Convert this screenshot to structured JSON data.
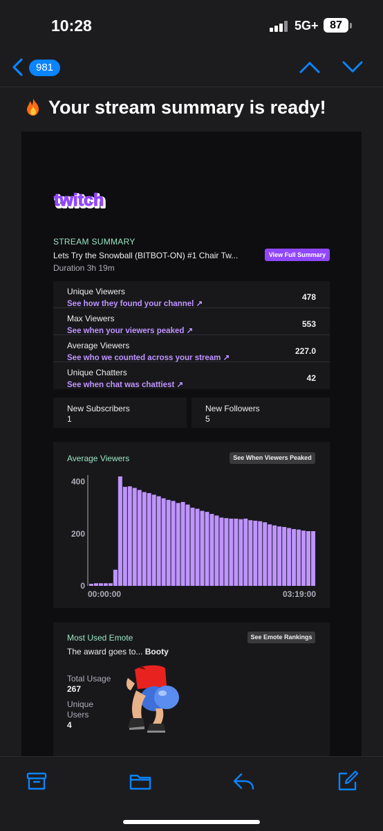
{
  "status": {
    "time": "10:28",
    "network": "5G+",
    "battery": "87"
  },
  "nav": {
    "unread_count": "981"
  },
  "email": {
    "subject": "Your stream summary is ready!",
    "logo_text": "twitch",
    "summary_label": "STREAM SUMMARY",
    "stream_title": "Lets Try the Snowball (BITBOT-ON) #1 Chair Tw...",
    "duration": "Duration 3h 19m",
    "full_summary_button": "View Full Summary",
    "metrics": [
      {
        "label": "Unique Viewers",
        "link": "See how they found your channel",
        "value": "478"
      },
      {
        "label": "Max Viewers",
        "link": "See when your viewers peaked",
        "value": "553"
      },
      {
        "label": "Average Viewers",
        "link": "See who we counted across your stream",
        "value": "227.0"
      },
      {
        "label": "Unique Chatters",
        "link": "See when chat was chattiest",
        "value": "42"
      }
    ],
    "tiles": [
      {
        "label": "New Subscribers",
        "value": "1"
      },
      {
        "label": "New Followers",
        "value": "5"
      }
    ],
    "chart_card": {
      "title": "Average Viewers",
      "button": "See When Viewers Peaked"
    },
    "emote": {
      "title": "Most Used Emote",
      "button": "See Emote Rankings",
      "award_prefix": "The award goes to...",
      "award_name": "Booty",
      "total_usage_label": "Total Usage",
      "total_usage_value": "267",
      "unique_users_label_1": "Unique",
      "unique_users_label_2": "Users",
      "unique_users_value": "4"
    }
  },
  "colors": {
    "accent": "#9147ff",
    "link": "#bf94ff",
    "bar": "#bf94ff",
    "mint": "#9be5c1",
    "ios_blue": "#0a84ff"
  },
  "chart_data": {
    "type": "bar",
    "title": "Average Viewers",
    "x_tick_labels": [
      "00:00:00",
      "03:19:00"
    ],
    "y_ticks": [
      0,
      200,
      400
    ],
    "ylim": [
      0,
      420
    ],
    "values": [
      8,
      10,
      10,
      10,
      10,
      62,
      420,
      380,
      382,
      376,
      368,
      360,
      356,
      350,
      344,
      336,
      330,
      326,
      318,
      322,
      312,
      300,
      296,
      288,
      284,
      276,
      270,
      262,
      260,
      258,
      258,
      256,
      258,
      252,
      250,
      248,
      244,
      236,
      232,
      228,
      226,
      222,
      218,
      216,
      212,
      210,
      210
    ]
  },
  "icons": {
    "toolbar": [
      "archive-icon",
      "folder-icon",
      "reply-icon",
      "compose-icon"
    ]
  }
}
